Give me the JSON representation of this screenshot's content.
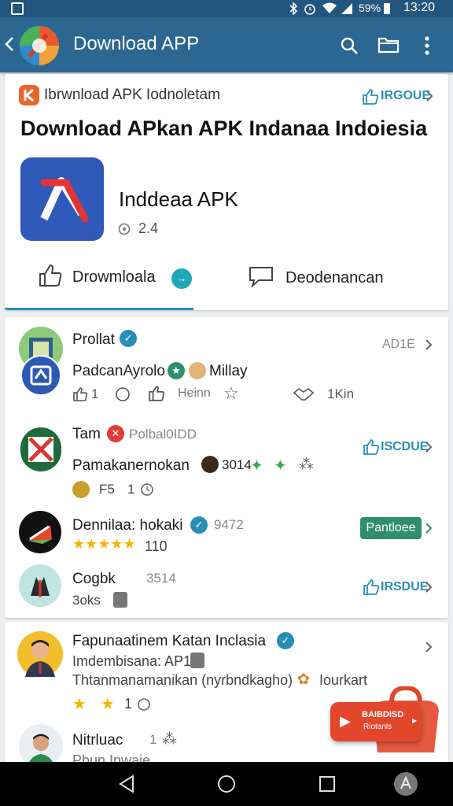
{
  "status_bar": {
    "battery": "59%",
    "time": "13:20"
  },
  "app_bar": {
    "title": "Download APP"
  },
  "featured": {
    "source_label": "Ibrwnload APK Iodnoletam",
    "issue_label": "IRGOUE",
    "heading": "Download APkan APK Indanaa Indoiesia",
    "app_name": "Inddeaa APK",
    "rating": "2.4",
    "download_label": "Drowmloala",
    "comment_label": "Deodenancan"
  },
  "list1": {
    "row1": {
      "name": "Prollat",
      "meta": "AD1E",
      "sub": "PadcanAyrolo",
      "sub_extra": "Millay",
      "like_count": "1",
      "reaction_text": "Heinn",
      "stat": "1Kin"
    },
    "row2": {
      "name": "Tam",
      "tag": "Polbal0IDD",
      "issue_label": "ISCDUE",
      "sub": "Pamakanernokan",
      "sub_num": "3014",
      "meta1": "F5",
      "meta2": "1"
    },
    "row3": {
      "name": "Dennilaa: hokaki",
      "num": "9472",
      "rating": "110",
      "button": "Pantloee"
    },
    "row4": {
      "name": "Cogbk",
      "num": "3514",
      "size": "3oks",
      "issue_label": "IRSDUE"
    }
  },
  "list2": {
    "row1": {
      "name": "Fapunaatinem Katan Inclasia",
      "line2": "Imdembisana: AP1",
      "line3": "Thtanmanamanikan (nyrbndkagho)",
      "line3_extra": "Iourkart",
      "count": "1"
    },
    "row2": {
      "name": "Nitrluac",
      "num": "1",
      "line2": "Pbun Inwaie"
    },
    "fab_line1": "BAIBDISD",
    "fab_line2": "Riotanls"
  },
  "colors": {
    "app_bar": "#2b6791",
    "accent": "#2a8db5",
    "green_button": "#2f8f6c",
    "fab": "#e2472b",
    "star": "#f4b400"
  }
}
